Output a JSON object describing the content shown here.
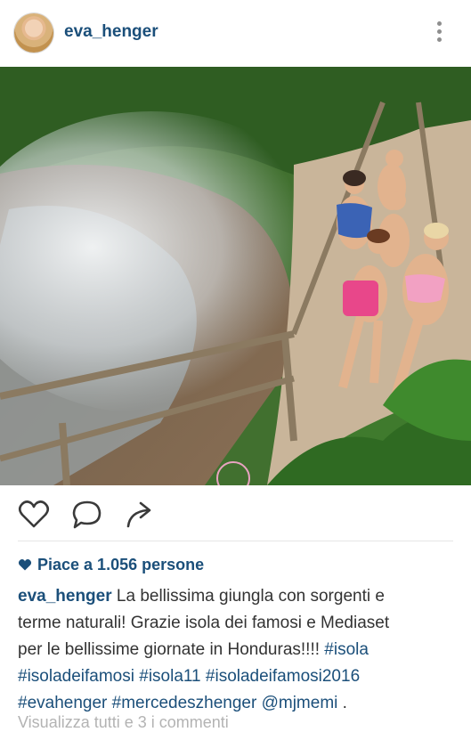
{
  "post": {
    "username": "eva_henger",
    "more_icon": "more-vertical-icon",
    "likes_text": "Piace a 1.056 persone",
    "caption": {
      "username": "eva_henger",
      "text_line1": "La bellissima giungla con sorgenti e",
      "text_line2": "terme naturali!  Grazie isola dei famosi e Mediaset",
      "text_line3": "per le bellissime giornate in Honduras!!!! ",
      "hashtags": [
        "#isola",
        "#isoladeifamosi",
        "#isola11",
        "#isoladeifamosi2016",
        "#evahenger",
        "#mercedeszhenger",
        "@mjmemi"
      ],
      "end": " ."
    },
    "comments_preview": "Visualizza tutti e 3 i commenti"
  },
  "icons": {
    "like": "heart-outline-icon",
    "comment": "comment-bubble-icon",
    "share": "share-arrow-icon",
    "likes_heart": "heart-filled-icon"
  },
  "colors": {
    "link": "#1b4f7a",
    "text": "#333333",
    "muted": "#b3b3b3"
  }
}
